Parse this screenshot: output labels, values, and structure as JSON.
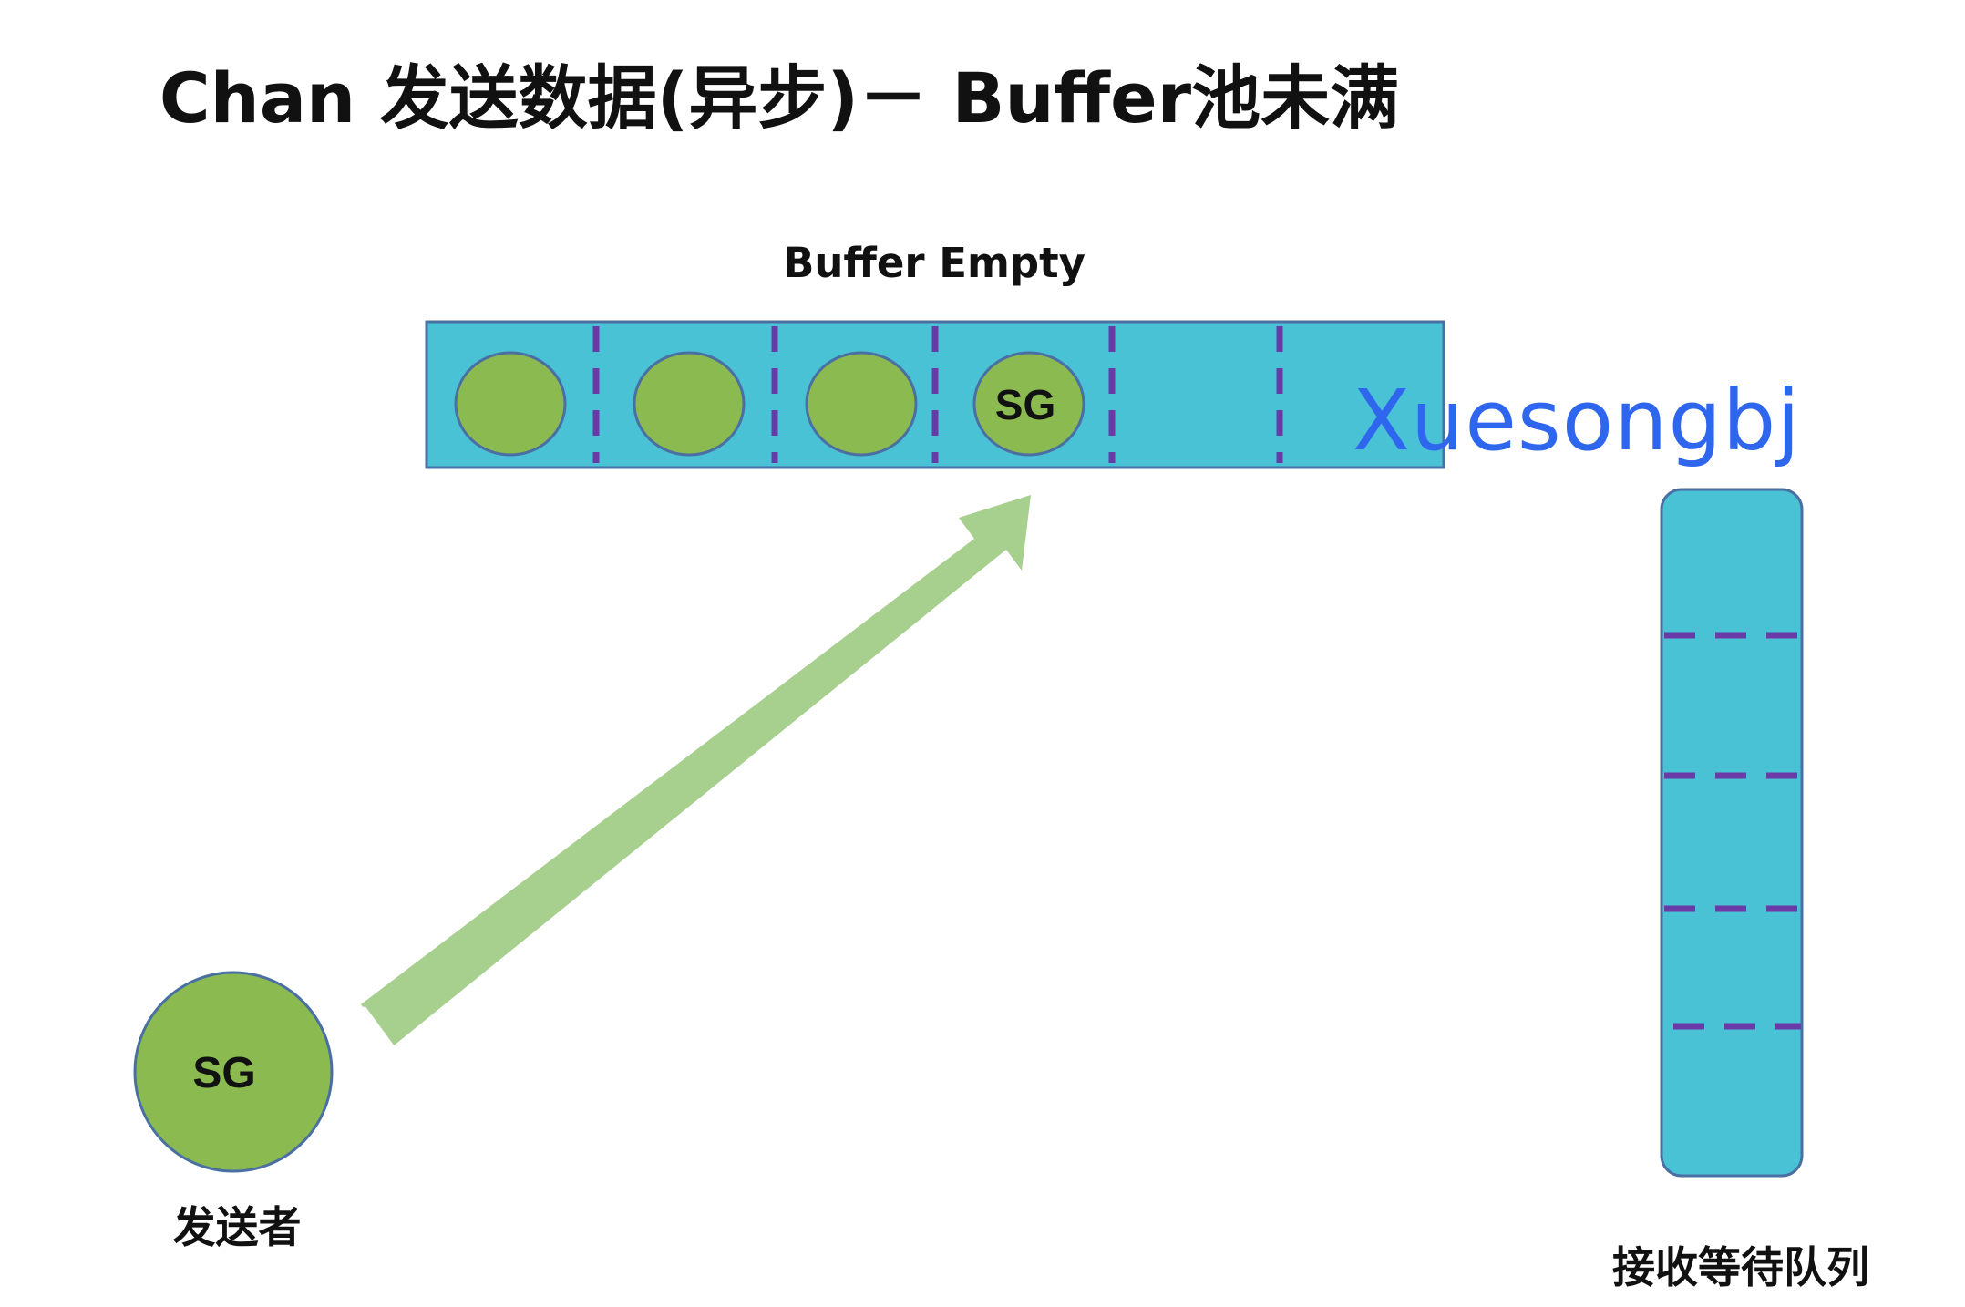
{
  "title": "Chan 发送数据(异步)－ Buffer池未满",
  "buffer": {
    "label": "Buffer Empty",
    "slots": [
      {
        "filled": true,
        "text": ""
      },
      {
        "filled": true,
        "text": ""
      },
      {
        "filled": true,
        "text": ""
      },
      {
        "filled": true,
        "text": "SG"
      },
      {
        "filled": false,
        "text": ""
      },
      {
        "filled": false,
        "text": ""
      }
    ]
  },
  "sender": {
    "circle_text": "SG",
    "label": "发送者"
  },
  "queue": {
    "label": "接收等待队列"
  },
  "watermark": "Xuesongbj",
  "colors": {
    "cyan": "#4ac2d6",
    "green": "#8bbb50",
    "arrow": "#a7cf8e",
    "divider": "#6a3aa6",
    "outline": "#4a6fa2"
  }
}
